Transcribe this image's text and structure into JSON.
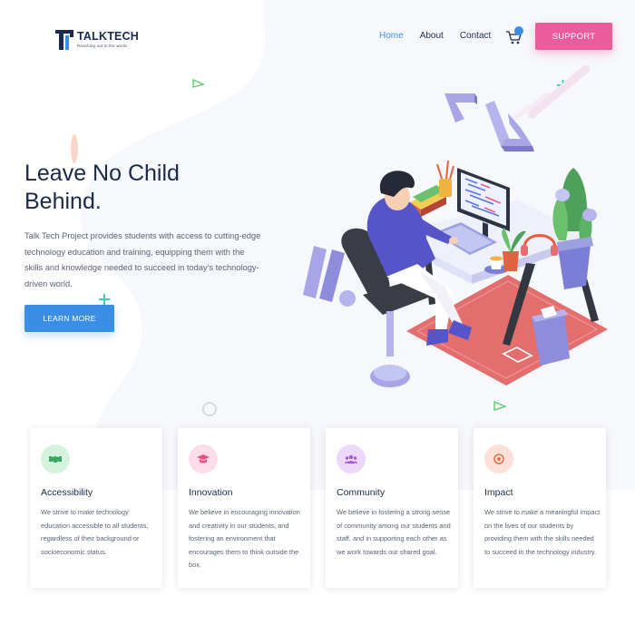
{
  "brand": {
    "name": "TALKTECH",
    "tagline": "Reaching out to the world"
  },
  "nav": {
    "items": [
      {
        "label": "Home",
        "active": true
      },
      {
        "label": "About",
        "active": false
      },
      {
        "label": "Contact",
        "active": false
      }
    ],
    "support_label": "SUPPORT",
    "cart_icon": "cart-icon"
  },
  "hero": {
    "title": "Leave No Child Behind.",
    "description": "Talk Tech Project provides students with access to cutting-edge technology education and training, equipping them with the skills and knowledge needed to succeed in today's technology-driven world.",
    "cta_label": "LEARN MORE"
  },
  "features": [
    {
      "title": "Accessibility",
      "text": "We strive to make technology education accessible to all students, regardless of their background or socioeconomic status.",
      "icon": "handshake-icon",
      "color": "#d5f2dc"
    },
    {
      "title": "Innovation",
      "text": "We believe in encouraging innovation and creativity in our students, and fostering an environment that encourages them to think outside the box.",
      "icon": "graduation-cap-icon",
      "color": "#fcdde9"
    },
    {
      "title": "Community",
      "text": "We believe in fostering a strong sense of community among our students and staff, and in supporting each other as we work towards our shared goal.",
      "icon": "people-icon",
      "color": "#ecd9fa"
    },
    {
      "title": "Impact",
      "text": "We strive to make a meaningful impact on the lives of our students by providing them with the skills needed to succeed in the technology industry.",
      "icon": "target-icon",
      "color": "#fde1d8"
    }
  ],
  "colors": {
    "primary": "#3a8ee6",
    "accent": "#ec5b9b",
    "heading": "#1b2a4a",
    "body": "#5a6275"
  }
}
